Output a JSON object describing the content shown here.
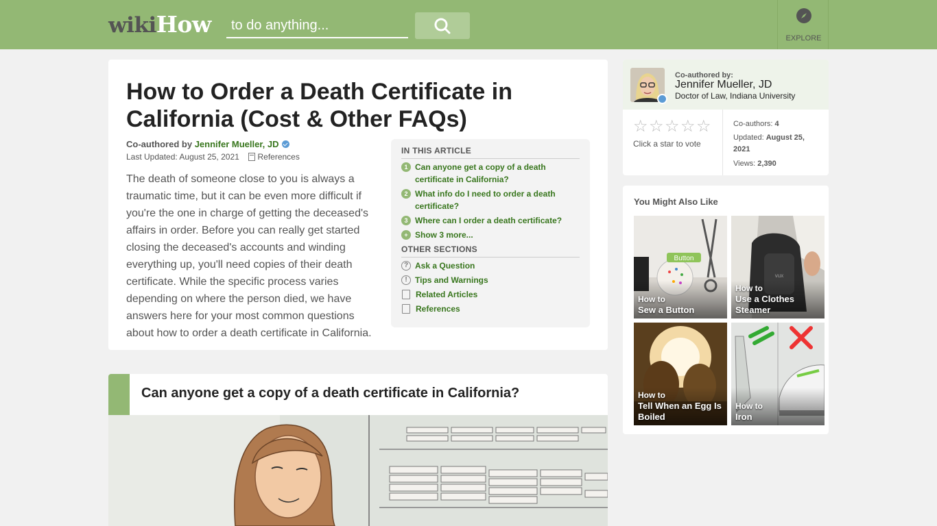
{
  "header": {
    "logo_wiki": "wiki",
    "logo_how": "How",
    "search_placeholder": "to do anything...",
    "explore_label": "EXPLORE",
    "colors": {
      "header_bg": "#93b874",
      "logo_dark": "#545454",
      "link_green": "#38761d"
    }
  },
  "article": {
    "title": "How to Order a Death Certificate in California (Cost & Other FAQs)",
    "coauthored_label": "Co-authored by",
    "author_name": "Jennifer Mueller, JD",
    "last_updated": "Last Updated: August 25, 2021",
    "references_label": "References",
    "intro": "The death of someone close to you is always a traumatic time, but it can be even more difficult if you're the one in charge of getting the deceased's affairs in order. Before you can really get started closing the deceased's accounts and winding everything up, you'll need copies of their death certificate. While the specific process varies depending on where the person died, we have answers here for your most common questions about how to order a death certificate in California."
  },
  "toc": {
    "heading": "IN THIS ARTICLE",
    "items": [
      {
        "num": "1",
        "label": "Can anyone get a copy of a death certificate in California?"
      },
      {
        "num": "2",
        "label": "What info do I need to order a death certificate?"
      },
      {
        "num": "3",
        "label": "Where can I order a death certificate?"
      },
      {
        "num": "+",
        "label": "Show 3 more..."
      }
    ],
    "other_heading": "OTHER SECTIONS",
    "other_items": [
      {
        "icon": "question-circle-icon",
        "label": "Ask a Question"
      },
      {
        "icon": "exclamation-circle-icon",
        "label": "Tips and Warnings"
      },
      {
        "icon": "document-icon",
        "label": "Related Articles"
      },
      {
        "icon": "bookmark-icon",
        "label": "References"
      }
    ]
  },
  "section1": {
    "title": "Can anyone get a copy of a death certificate in California?"
  },
  "author_card": {
    "coauthored_by": "Co-authored by:",
    "name": "Jennifer Mueller, JD",
    "degree": "Doctor of Law, Indiana University",
    "rating_stars": 0,
    "rating_max": 5,
    "vote_prompt": "Click a star to vote",
    "coauthors_label": "Co-authors:",
    "coauthors_value": "4",
    "updated_label": "Updated:",
    "updated_value": "August 25, 2021",
    "views_label": "Views:",
    "views_value": "2,390"
  },
  "related": {
    "heading": "You Might Also Like",
    "tiles": [
      {
        "howto": "How to",
        "title": "Sew a Button"
      },
      {
        "howto": "How to",
        "title": "Use a Clothes Steamer"
      },
      {
        "howto": "How to",
        "title": "Tell When an Egg Is Boiled"
      },
      {
        "howto": "How to",
        "title": "Iron"
      }
    ]
  }
}
